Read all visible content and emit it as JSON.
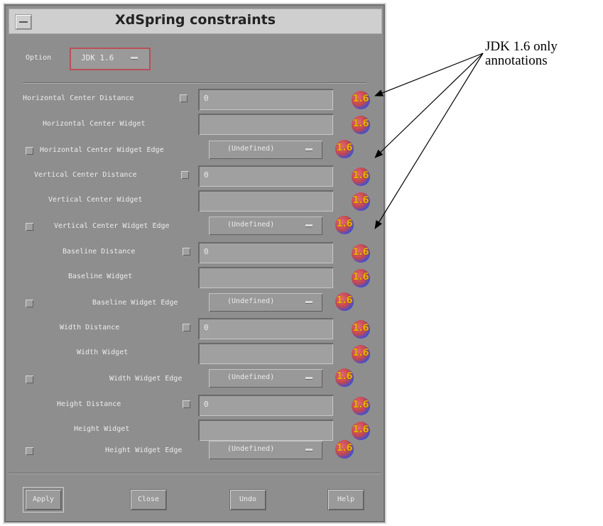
{
  "window": {
    "title": "XdSpring constraints"
  },
  "option": {
    "label": "Option",
    "value": "JDK 1.6"
  },
  "rows": [
    {
      "label": "Horizontal Center Distance",
      "field": "0"
    },
    {
      "label": "Horizontal Center Widget",
      "field": ""
    },
    {
      "label": "Horizontal Center Widget Edge",
      "combo": "(Undefined)"
    },
    {
      "label": "Vertical Center Distance",
      "field": "0"
    },
    {
      "label": "Vertical Center Widget",
      "field": ""
    },
    {
      "label": "Vertical Center Widget Edge",
      "combo": "(Undefined)"
    },
    {
      "label": "Baseline Distance",
      "field": "0"
    },
    {
      "label": "Baseline Widget",
      "field": ""
    },
    {
      "label": "Baseline Widget Edge",
      "combo": "(Undefined)"
    },
    {
      "label": "Width Distance",
      "field": "0"
    },
    {
      "label": "Width Widget",
      "field": ""
    },
    {
      "label": "Width Widget Edge",
      "combo": "(Undefined)"
    },
    {
      "label": "Height Distance",
      "field": "0"
    },
    {
      "label": "Height Widget",
      "field": ""
    },
    {
      "label": "Height Widget Edge",
      "combo": "(Undefined)"
    }
  ],
  "badge_text": "1.6",
  "buttons": {
    "apply": "Apply",
    "close": "Close",
    "undo": "Undo",
    "help": "Help"
  },
  "annotation": {
    "line1": "JDK 1.6 only",
    "line2": "annotations"
  },
  "colors": {
    "dialog_bg": "#8e8e8e",
    "titlebar": "#cfcfcf",
    "option_border": "#b8505a",
    "badge_red": "#c4474f",
    "badge_blue": "#3b4fd6",
    "badge_text": "#e8b000"
  }
}
